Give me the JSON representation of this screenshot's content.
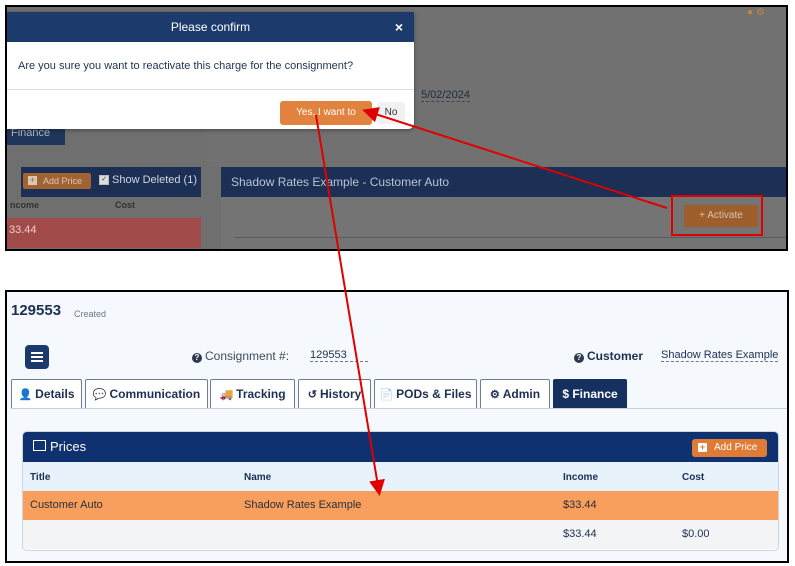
{
  "modal": {
    "title": "Please confirm",
    "close_icon": "close-icon",
    "message": "Are you sure you want to reactivate this charge for the consignment?",
    "yes_label": "Yes, I want to",
    "no_label": "No"
  },
  "top": {
    "date_fragment": "5/02/2024",
    "finance_tab_fragment": "Finance",
    "add_price_label": "Add Price",
    "show_deleted_label": "Show Deleted (1)",
    "income_header_fragment": "ncome",
    "cost_header": "Cost",
    "deleted_income_fragment": "33.44",
    "charge_title": "Shadow Rates Example - Customer Auto",
    "activate_label": "Activate"
  },
  "bottom": {
    "consignment_id": "129553",
    "status": "Created",
    "consignment_label": "Consignment #:",
    "consignment_value": "129553",
    "customer_label": "Customer",
    "customer_value": "Shadow Rates Example",
    "tabs": [
      {
        "label": "Details",
        "icon": "user-icon"
      },
      {
        "label": "Communication",
        "icon": "comment-icon"
      },
      {
        "label": "Tracking",
        "icon": "truck-icon"
      },
      {
        "label": "History",
        "icon": "history-icon"
      },
      {
        "label": "PODs & Files",
        "icon": "file-icon"
      },
      {
        "label": "Admin",
        "icon": "gear-icon"
      },
      {
        "label": "$ Finance",
        "icon": "dollar-icon",
        "active": true
      }
    ],
    "prices": {
      "title": "Prices",
      "add_price_label": "Add Price",
      "columns": [
        "Title",
        "Name",
        "Income",
        "Cost"
      ],
      "rows": [
        {
          "title": "Customer Auto",
          "name": "Shadow Rates Example",
          "income": "$33.44",
          "cost": ""
        }
      ],
      "totals": {
        "income": "$33.44",
        "cost": "$0.00"
      }
    }
  },
  "colors": {
    "navy": "#1c3a6b",
    "orange": "#e2823f",
    "highlight_row": "#f89f5e",
    "annotation_red": "#e00000"
  }
}
